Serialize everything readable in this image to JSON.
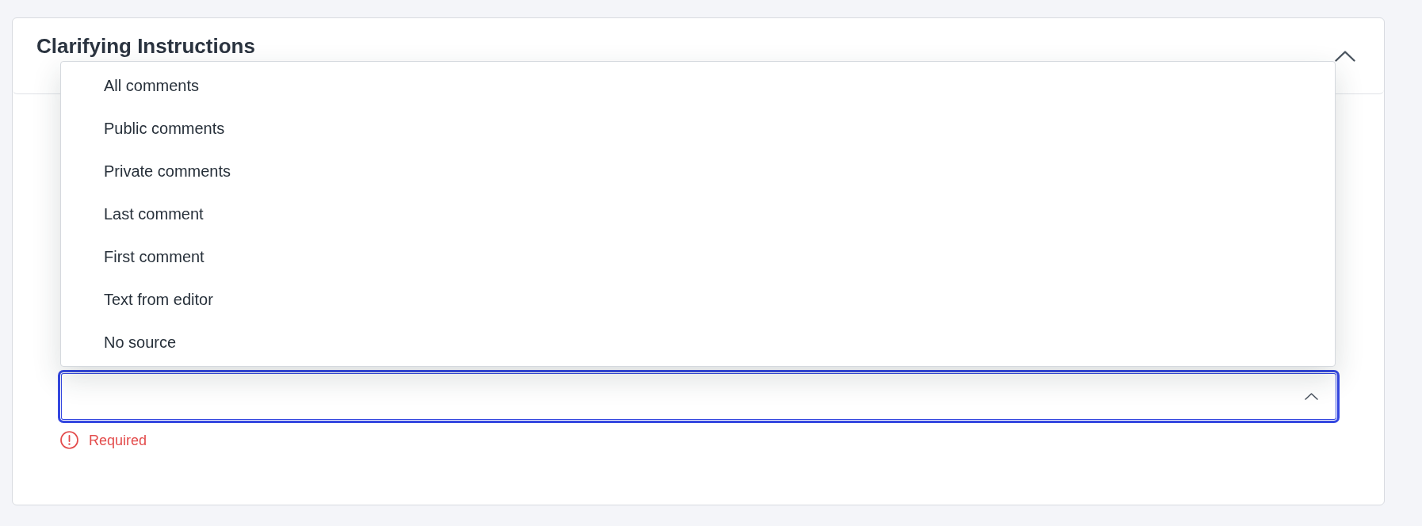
{
  "section": {
    "title": "Clarifying Instructions",
    "expanded": true
  },
  "select": {
    "focused": true,
    "open": true,
    "options": [
      {
        "label": "All comments",
        "selected": false
      },
      {
        "label": "Public comments",
        "selected": false
      },
      {
        "label": "Private comments",
        "selected": false
      },
      {
        "label": "Last comment",
        "selected": false
      },
      {
        "label": "First comment",
        "selected": false
      },
      {
        "label": "Text from editor",
        "selected": false
      },
      {
        "label": "No source",
        "selected": false
      }
    ],
    "error": "Required"
  }
}
